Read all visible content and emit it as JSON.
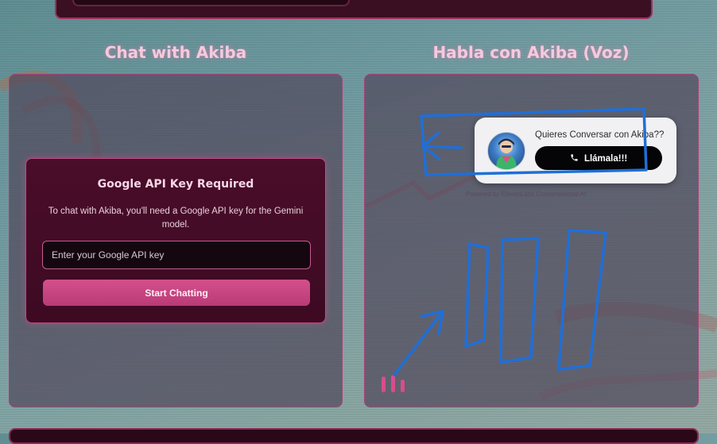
{
  "sections": {
    "chat_title": "Chat with Akiba",
    "voice_title": "Habla con Akiba (Voz)"
  },
  "api_card": {
    "title": "Google API Key Required",
    "description": "To chat with Akiba, you'll need a Google API key for the Gemini model.",
    "input_placeholder": "Enter your Google API key",
    "input_value": "",
    "button_label": "Start Chatting"
  },
  "call_widget": {
    "question": "Quieres Conversar con Akiba??",
    "call_button_label": "Llámala!!!",
    "call_icon": "phone-icon",
    "powered_by": "Powered by ElevenLabs Conversational AI"
  },
  "colors": {
    "accent_pink": "#d4508d",
    "panel_border": "#a8417a",
    "annotation_blue": "#1f6fd8"
  },
  "mic_levels": [
    0.75,
    0.85,
    0.6
  ]
}
